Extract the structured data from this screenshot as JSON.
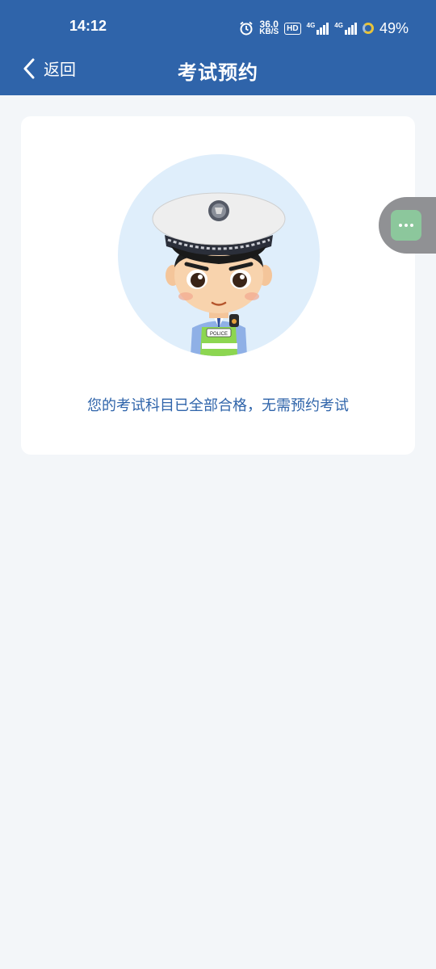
{
  "status_bar": {
    "time": "14:12",
    "net_speed_value": "36.0",
    "net_speed_unit": "KB/S",
    "hd_label": "HD",
    "signal1_label": "4G",
    "signal2_label": "4G",
    "battery": "49%"
  },
  "header": {
    "back_label": "返回",
    "title": "考试预约"
  },
  "card": {
    "badge_text": "POLICE",
    "message": "您的考试科目已全部合格，无需预约考试"
  },
  "colors": {
    "header_bg": "#2f64aa",
    "page_bg": "#f3f6f9",
    "message_text": "#2f64aa",
    "float_button": "#8cc79c"
  },
  "icons": {
    "back": "chevron-left-icon",
    "alarm": "alarm-icon",
    "more": "more-dots-icon"
  }
}
